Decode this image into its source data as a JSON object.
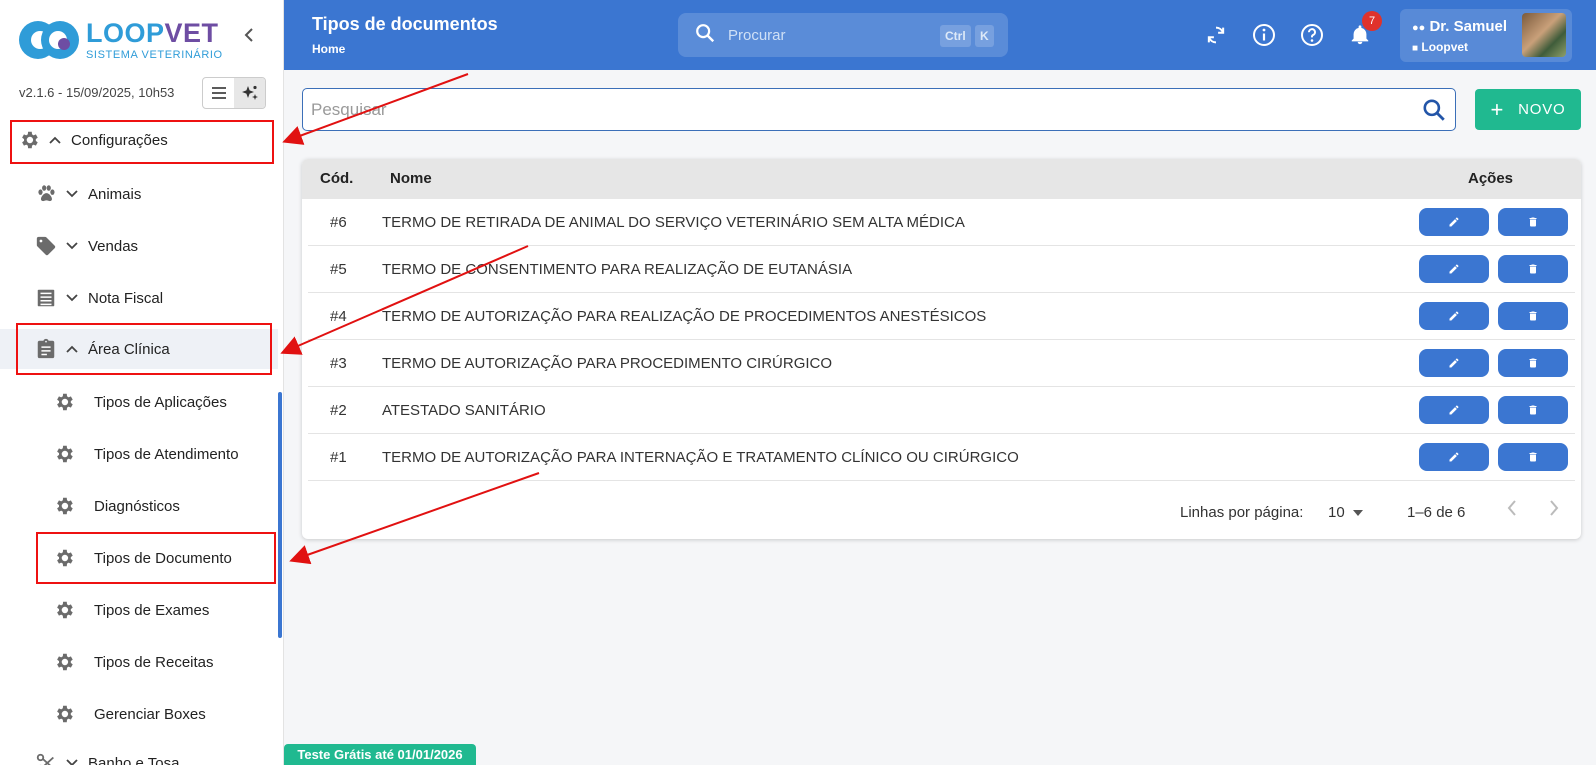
{
  "brand": {
    "name_part1": "LOOP",
    "name_part2": "VET",
    "subtitle": "SISTEMA VETERINÁRIO"
  },
  "sidebar": {
    "version": "v2.1.6 - 15/09/2025, 10h53",
    "items": [
      {
        "label": "Configurações",
        "icon": "gear-icon",
        "chevron": "up"
      },
      {
        "label": "Animais",
        "icon": "paw-icon",
        "chevron": "down"
      },
      {
        "label": "Vendas",
        "icon": "tag-icon",
        "chevron": "down"
      },
      {
        "label": "Nota Fiscal",
        "icon": "receipt-icon",
        "chevron": "down"
      },
      {
        "label": "Área Clínica",
        "icon": "clipboard-icon",
        "chevron": "up"
      },
      {
        "label": "Tipos de Aplicações",
        "icon": "gear-icon"
      },
      {
        "label": "Tipos de Atendimento",
        "icon": "gear-icon"
      },
      {
        "label": "Diagnósticos",
        "icon": "gear-icon"
      },
      {
        "label": "Tipos de Documento",
        "icon": "gear-icon"
      },
      {
        "label": "Tipos de Exames",
        "icon": "gear-icon"
      },
      {
        "label": "Tipos de Receitas",
        "icon": "gear-icon"
      },
      {
        "label": "Gerenciar Boxes",
        "icon": "gear-icon"
      },
      {
        "label": "Banho e Tosa",
        "icon": "scissors-icon",
        "chevron": "down"
      }
    ]
  },
  "header": {
    "title": "Tipos de documentos",
    "breadcrumb": "Home",
    "search_placeholder": "Procurar",
    "shortcut_key1": "Ctrl",
    "shortcut_key2": "K",
    "notifications_count": "7",
    "user_name": "Dr. Samuel",
    "user_org": "Loopvet"
  },
  "main": {
    "search_placeholder": "Pesquisar",
    "new_button": "NOVO",
    "table": {
      "columns": {
        "code": "Cód.",
        "name": "Nome",
        "actions": "Ações"
      },
      "rows": [
        {
          "code": "#6",
          "name": "TERMO DE RETIRADA DE ANIMAL DO SERVIÇO VETERINÁRIO SEM ALTA MÉDICA"
        },
        {
          "code": "#5",
          "name": "TERMO DE CONSENTIMENTO PARA REALIZAÇÃO DE EUTANÁSIA"
        },
        {
          "code": "#4",
          "name": "TERMO DE AUTORIZAÇÃO PARA REALIZAÇÃO DE PROCEDIMENTOS ANESTÉSICOS"
        },
        {
          "code": "#3",
          "name": "TERMO DE AUTORIZAÇÃO PARA PROCEDIMENTO CIRÚRGICO"
        },
        {
          "code": "#2",
          "name": "ATESTADO SANITÁRIO"
        },
        {
          "code": "#1",
          "name": "TERMO DE AUTORIZAÇÃO PARA INTERNAÇÃO E TRATAMENTO CLÍNICO OU CIRÚRGICO"
        }
      ]
    },
    "pagination": {
      "rows_per_page_label": "Linhas por página:",
      "rows_per_page": "10",
      "range": "1–6 de 6"
    }
  },
  "trial_banner": "Teste Grátis até 01/01/2026",
  "colors": {
    "primary": "#3b76d1",
    "accent": "#20b990",
    "annotation": "#e11111",
    "badge": "#e0322b"
  }
}
